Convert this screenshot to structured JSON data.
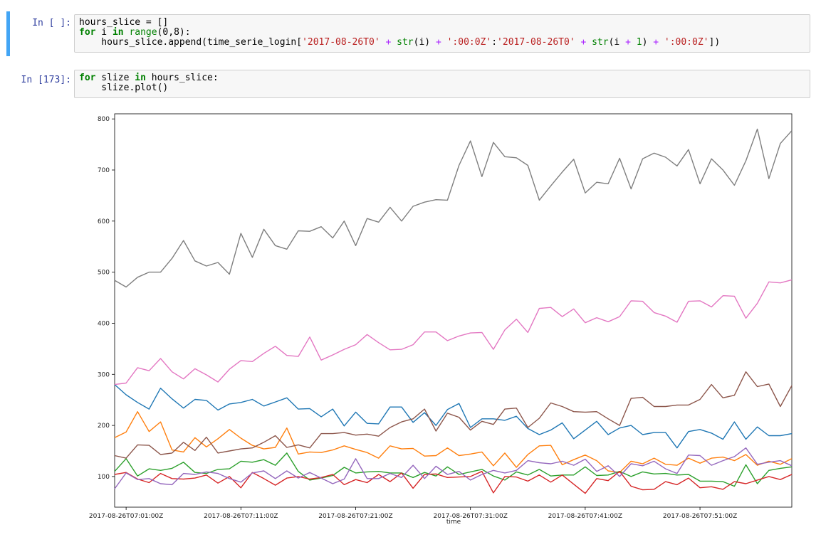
{
  "cells": [
    {
      "prompt": "In [ ]:",
      "lines": [
        [
          [
            "ident",
            "hours_slice = []"
          ]
        ],
        [
          [
            "kw",
            "for"
          ],
          [
            "plain",
            " i "
          ],
          [
            "kw",
            "in"
          ],
          [
            "plain",
            " "
          ],
          [
            "bi",
            "range"
          ],
          [
            "plain",
            "(0,8):"
          ]
        ],
        [
          [
            "plain",
            "    hours_slice.append(time_serie_login["
          ],
          [
            "str",
            "'2017-08-26T0'"
          ],
          [
            "plain",
            " "
          ],
          [
            "op",
            "+"
          ],
          [
            "plain",
            " "
          ],
          [
            "bi",
            "str"
          ],
          [
            "plain",
            "(i) "
          ],
          [
            "op",
            "+"
          ],
          [
            "plain",
            " "
          ],
          [
            "str",
            "':00:0Z'"
          ],
          [
            "plain",
            ":"
          ],
          [
            "str",
            "'2017-08-26T0'"
          ],
          [
            "plain",
            " "
          ],
          [
            "op",
            "+"
          ],
          [
            "plain",
            " "
          ],
          [
            "bi",
            "str"
          ],
          [
            "plain",
            "(i "
          ],
          [
            "op",
            "+"
          ],
          [
            "plain",
            " "
          ],
          [
            "num",
            "1"
          ],
          [
            "plain",
            ") "
          ],
          [
            "op",
            "+"
          ],
          [
            "plain",
            " "
          ],
          [
            "str",
            "':00:0Z'"
          ],
          [
            "plain",
            "])"
          ]
        ]
      ]
    },
    {
      "prompt": "In [173]:",
      "lines": [
        [
          [
            "kw",
            "for"
          ],
          [
            "plain",
            " slize "
          ],
          [
            "kw",
            "in"
          ],
          [
            "plain",
            " hours_slice:"
          ]
        ],
        [
          [
            "plain",
            "    slize.plot()"
          ]
        ]
      ]
    }
  ],
  "chart_data": {
    "type": "line",
    "xlabel": "time",
    "ylabel": "",
    "ylim": [
      40,
      810
    ],
    "yticks": [
      100,
      200,
      300,
      400,
      500,
      600,
      700,
      800
    ],
    "xtick_labels": [
      "2017-08-26T07:01:00Z",
      "2017-08-26T07:11:00Z",
      "2017-08-26T07:21:00Z",
      "2017-08-26T07:31:00Z",
      "2017-08-26T07:41:00Z",
      "2017-08-26T07:51:00Z"
    ],
    "xtick_minutes": [
      1,
      11,
      21,
      31,
      41,
      51
    ],
    "x_minutes_range": [
      0,
      59
    ],
    "series": [
      {
        "color": "#1f77b4",
        "values": [
          280,
          260,
          245,
          232,
          273,
          252,
          234,
          251,
          249,
          230,
          242,
          245,
          251,
          238,
          246,
          254,
          232,
          233,
          217,
          232,
          199,
          226,
          204,
          203,
          236,
          236,
          206,
          225,
          200,
          231,
          243,
          196,
          213,
          213,
          210,
          218,
          194,
          182,
          191,
          205,
          174,
          191,
          208,
          182,
          195,
          200,
          182,
          186,
          186,
          156,
          188,
          192,
          185,
          173,
          207,
          173,
          197,
          180,
          180,
          184
        ]
      },
      {
        "color": "#ff7f0e",
        "values": [
          176,
          187,
          227,
          188,
          207,
          152,
          148,
          176,
          158,
          174,
          192,
          175,
          161,
          154,
          157,
          195,
          144,
          148,
          147,
          152,
          160,
          153,
          147,
          136,
          160,
          154,
          155,
          140,
          141,
          156,
          141,
          144,
          148,
          121,
          146,
          118,
          143,
          160,
          161,
          123,
          133,
          142,
          131,
          111,
          108,
          130,
          125,
          136,
          124,
          122,
          136,
          126,
          136,
          138,
          131,
          143,
          122,
          130,
          124,
          135
        ]
      },
      {
        "color": "#2ca02c",
        "values": [
          110,
          135,
          101,
          115,
          112,
          116,
          128,
          108,
          106,
          114,
          115,
          130,
          128,
          133,
          122,
          146,
          110,
          93,
          97,
          102,
          118,
          107,
          109,
          110,
          107,
          107,
          98,
          108,
          101,
          119,
          104,
          109,
          114,
          101,
          93,
          109,
          103,
          114,
          101,
          103,
          103,
          119,
          102,
          103,
          110,
          100,
          109,
          105,
          106,
          103,
          104,
          91,
          91,
          90,
          81,
          123,
          86,
          112,
          116,
          119
        ]
      },
      {
        "color": "#d62728",
        "values": [
          104,
          108,
          95,
          88,
          106,
          96,
          95,
          97,
          103,
          87,
          100,
          78,
          108,
          96,
          83,
          97,
          100,
          95,
          98,
          104,
          84,
          94,
          88,
          104,
          90,
          107,
          77,
          104,
          105,
          98,
          99,
          100,
          110,
          68,
          100,
          99,
          91,
          103,
          89,
          103,
          85,
          67,
          96,
          92,
          110,
          81,
          74,
          75,
          90,
          84,
          97,
          78,
          80,
          75,
          90,
          86,
          93,
          100,
          94,
          104
        ]
      },
      {
        "color": "#9467bd",
        "values": [
          76,
          107,
          94,
          96,
          86,
          84,
          106,
          104,
          109,
          106,
          96,
          89,
          107,
          111,
          96,
          111,
          97,
          108,
          97,
          86,
          95,
          135,
          96,
          96,
          106,
          98,
          122,
          96,
          120,
          104,
          110,
          93,
          104,
          112,
          107,
          112,
          131,
          127,
          125,
          130,
          122,
          134,
          110,
          121,
          100,
          125,
          121,
          130,
          115,
          106,
          142,
          141,
          122,
          131,
          139,
          156,
          124,
          128,
          131,
          121
        ]
      },
      {
        "color": "#8c564b",
        "values": [
          141,
          136,
          162,
          161,
          143,
          146,
          167,
          151,
          177,
          146,
          150,
          154,
          156,
          167,
          180,
          157,
          162,
          156,
          184,
          184,
          186,
          181,
          183,
          179,
          196,
          207,
          213,
          232,
          189,
          224,
          216,
          191,
          208,
          202,
          232,
          234,
          196,
          214,
          244,
          237,
          227,
          226,
          227,
          213,
          200,
          253,
          255,
          237,
          237,
          240,
          240,
          251,
          280,
          254,
          259,
          305,
          276,
          281,
          237,
          278
        ]
      },
      {
        "color": "#e377c2",
        "values": [
          280,
          283,
          313,
          307,
          331,
          305,
          291,
          311,
          299,
          285,
          310,
          327,
          325,
          341,
          355,
          337,
          335,
          373,
          328,
          338,
          349,
          358,
          378,
          362,
          348,
          349,
          358,
          383,
          383,
          366,
          375,
          381,
          382,
          349,
          387,
          408,
          382,
          429,
          431,
          413,
          428,
          401,
          411,
          403,
          413,
          444,
          443,
          421,
          414,
          402,
          443,
          444,
          432,
          454,
          453,
          410,
          439,
          481,
          479,
          485
        ]
      },
      {
        "color": "#7f7f7f",
        "values": [
          484,
          471,
          490,
          500,
          500,
          527,
          562,
          522,
          512,
          519,
          496,
          576,
          529,
          584,
          552,
          545,
          581,
          580,
          589,
          567,
          600,
          552,
          605,
          598,
          627,
          600,
          629,
          637,
          642,
          641,
          709,
          757,
          687,
          754,
          726,
          724,
          709,
          641,
          669,
          696,
          721,
          655,
          676,
          673,
          723,
          663,
          722,
          733,
          725,
          708,
          740,
          673,
          722,
          700,
          670,
          718,
          780,
          683,
          752,
          777
        ]
      }
    ]
  }
}
